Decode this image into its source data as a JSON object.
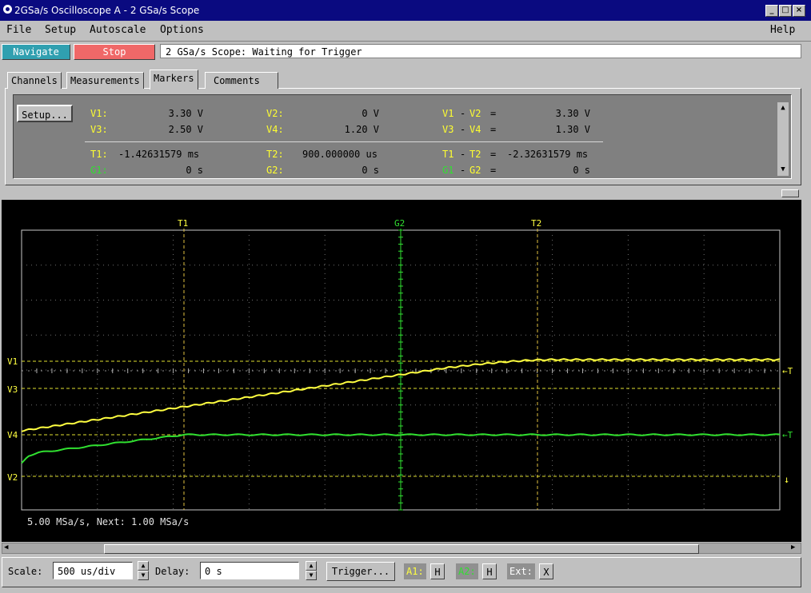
{
  "window": {
    "title": "2GSa/s Oscilloscope A - 2 GSa/s Scope"
  },
  "menu": {
    "file": "File",
    "setup": "Setup",
    "autoscale": "Autoscale",
    "options": "Options",
    "help": "Help"
  },
  "controls": {
    "navigate": "Navigate",
    "stop": "Stop",
    "status": "2 GSa/s Scope: Waiting for Trigger"
  },
  "tabs": {
    "channels": "Channels",
    "measurements": "Measurements",
    "markers": "Markers",
    "comments": "Comments"
  },
  "markers": {
    "setup_label": "Setup...",
    "v1": {
      "label": "V1:",
      "value": "3.30 V"
    },
    "v2": {
      "label": "V2:",
      "value": "0 V"
    },
    "v1_v2": {
      "a": "V1",
      "b": "V2",
      "value": "3.30 V"
    },
    "v3": {
      "label": "V3:",
      "value": "2.50 V"
    },
    "v4": {
      "label": "V4:",
      "value": "1.20 V"
    },
    "v3_v4": {
      "a": "V3",
      "b": "V4",
      "value": "1.30 V"
    },
    "t1": {
      "label": "T1:",
      "value": "-1.42631579 ms"
    },
    "t2": {
      "label": "T2:",
      "value": "900.000000 us"
    },
    "t1_t2": {
      "a": "T1",
      "b": "T2",
      "value": "-2.32631579 ms"
    },
    "g1": {
      "label": "G1:",
      "value": "0 s"
    },
    "g2": {
      "label": "G2:",
      "value": "0 s"
    },
    "g1_g2": {
      "a": "G1",
      "b": "G2",
      "value": "0 s"
    },
    "minus": "-",
    "equals": "="
  },
  "scope": {
    "marker_labels": {
      "t1": "T1",
      "g2": "G2",
      "t2": "T2",
      "v1": "V1",
      "v3": "V3",
      "v4": "V4",
      "v2": "V2",
      "trig": "←T"
    },
    "sample_info": "5.00 MSa/s, Next: 1.00 MSa/s",
    "colors": {
      "channel1": "#ffff40",
      "channel2": "#30e030",
      "grid": "#c8c8c8",
      "background": "#000000"
    }
  },
  "bottom": {
    "scale_label": "Scale:",
    "scale_value": "500 us/div",
    "delay_label": "Delay:",
    "delay_value": "0 s",
    "trigger": "Trigger...",
    "a1": "A1:",
    "a1_btn": "H",
    "a2": "A2:",
    "a2_btn": "H",
    "ext": "Ext:",
    "ext_btn": "X"
  }
}
